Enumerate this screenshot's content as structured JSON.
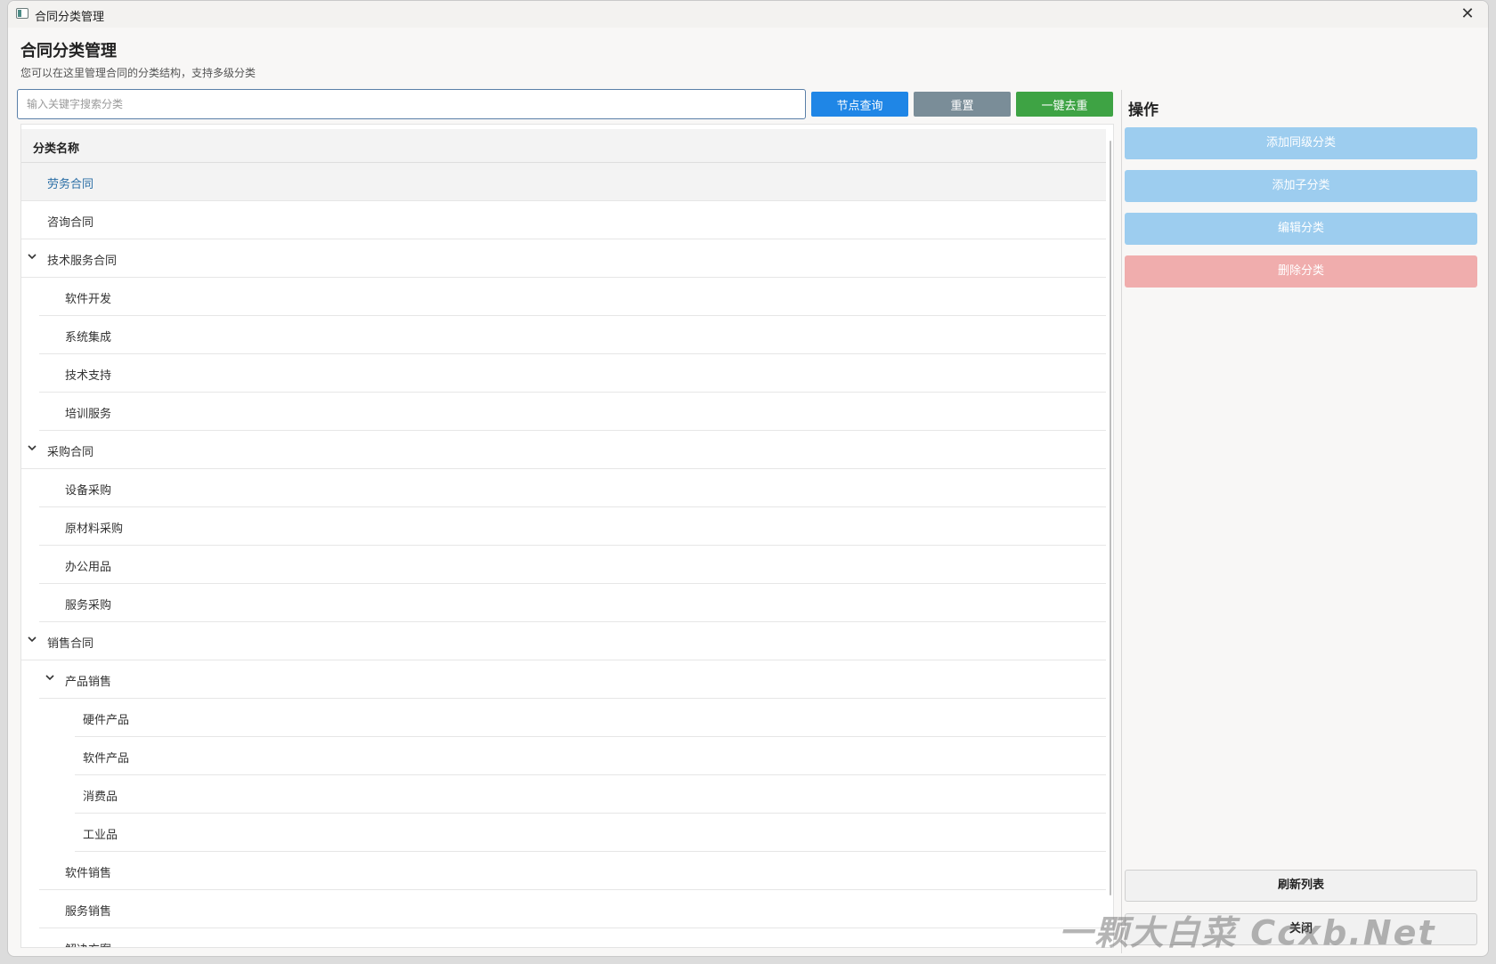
{
  "window": {
    "title": "合同分类管理",
    "close_glyph": "✕"
  },
  "page": {
    "title": "合同分类管理",
    "subtitle": "您可以在这里管理合同的分类结构，支持多级分类"
  },
  "search": {
    "placeholder": "输入关键字搜索分类",
    "value": ""
  },
  "toolbar": {
    "query_label": "节点查询",
    "reset_label": "重置",
    "dedupe_label": "一键去重"
  },
  "tree": {
    "header": "分类名称",
    "rows": [
      {
        "label": "劳务合同",
        "level": 0,
        "expandable": false,
        "selected": true
      },
      {
        "label": "咨询合同",
        "level": 0,
        "expandable": false,
        "selected": false
      },
      {
        "label": "技术服务合同",
        "level": 0,
        "expandable": true,
        "selected": false
      },
      {
        "label": "软件开发",
        "level": 1,
        "expandable": false,
        "selected": false
      },
      {
        "label": "系统集成",
        "level": 1,
        "expandable": false,
        "selected": false
      },
      {
        "label": "技术支持",
        "level": 1,
        "expandable": false,
        "selected": false
      },
      {
        "label": "培训服务",
        "level": 1,
        "expandable": false,
        "selected": false
      },
      {
        "label": "采购合同",
        "level": 0,
        "expandable": true,
        "selected": false
      },
      {
        "label": "设备采购",
        "level": 1,
        "expandable": false,
        "selected": false
      },
      {
        "label": "原材料采购",
        "level": 1,
        "expandable": false,
        "selected": false
      },
      {
        "label": "办公用品",
        "level": 1,
        "expandable": false,
        "selected": false
      },
      {
        "label": "服务采购",
        "level": 1,
        "expandable": false,
        "selected": false
      },
      {
        "label": "销售合同",
        "level": 0,
        "expandable": true,
        "selected": false
      },
      {
        "label": "产品销售",
        "level": 1,
        "expandable": true,
        "selected": false
      },
      {
        "label": "硬件产品",
        "level": 2,
        "expandable": false,
        "selected": false
      },
      {
        "label": "软件产品",
        "level": 2,
        "expandable": false,
        "selected": false
      },
      {
        "label": "消费品",
        "level": 2,
        "expandable": false,
        "selected": false
      },
      {
        "label": "工业品",
        "level": 2,
        "expandable": false,
        "selected": false
      },
      {
        "label": "软件销售",
        "level": 1,
        "expandable": false,
        "selected": false
      },
      {
        "label": "服务销售",
        "level": 1,
        "expandable": false,
        "selected": false
      },
      {
        "label": "解决方案",
        "level": 1,
        "expandable": false,
        "selected": false
      }
    ]
  },
  "operations": {
    "title": "操作",
    "add_sibling_label": "添加同级分类",
    "add_child_label": "添加子分类",
    "edit_label": "编辑分类",
    "delete_label": "删除分类",
    "refresh_label": "刷新列表",
    "close_label": "关闭"
  },
  "watermark": "一颗大白菜 Ccxb.Net",
  "colors": {
    "query": "#1f86e6",
    "reset": "#7a8d98",
    "dedupe": "#3ea344",
    "primary_disabled": "#9dcdef",
    "danger_disabled": "#f0adad",
    "selected_text": "#2a6ea6"
  }
}
